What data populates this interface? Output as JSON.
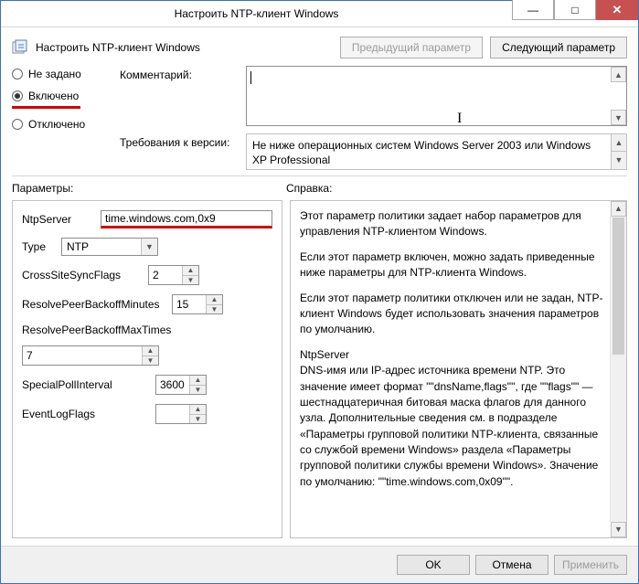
{
  "window": {
    "title": "Настроить NTP-клиент Windows"
  },
  "header": {
    "policy_name": "Настроить NTP-клиент Windows",
    "prev_btn": "Предыдущий параметр",
    "next_btn": "Следующий параметр"
  },
  "state": {
    "not_configured": "Не задано",
    "enabled": "Включено",
    "disabled": "Отключено"
  },
  "labels": {
    "comment": "Комментарий:",
    "requirements": "Требования к версии:",
    "requirements_text": "Не ниже операционных систем Windows Server 2003 или Windows XP Professional",
    "params": "Параметры:",
    "help": "Справка:"
  },
  "params": {
    "ntpserver_label": "NtpServer",
    "ntpserver_value": "time.windows.com,0x9",
    "type_label": "Type",
    "type_value": "NTP",
    "crosssite_label": "CrossSiteSyncFlags",
    "crosssite_value": "2",
    "resolve_label": "ResolvePeerBackoffMinutes",
    "resolve_value": "15",
    "resolvemax_label": "ResolvePeerBackoffMaxTimes",
    "resolvemax_value": "7",
    "special_label": "SpecialPollInterval",
    "special_value": "3600",
    "eventlog_label": "EventLogFlags"
  },
  "help": {
    "p1": "Этот параметр политики задает набор параметров для управления NTP-клиентом Windows.",
    "p2": "Если этот параметр включен, можно задать приведенные ниже параметры для NTP-клиента Windows.",
    "p3": "Если этот параметр политики отключен или не задан, NTP-клиент Windows будет использовать значения параметров по умолчанию.",
    "p4_title": "NtpServer",
    "p4": "DNS-имя или IP-адрес источника времени NTP. Это значение имеет формат \"\"dnsName,flags\"\", где \"\"flags\"\" — шестнадцатеричная битовая маска флагов для данного узла. Дополнительные сведения см. в подразделе «Параметры групповой политики NTP-клиента, связанные со службой времени Windows» раздела «Параметры групповой политики службы времени Windows».   Значение по умолчанию: \"\"time.windows.com,0x09\"\"."
  },
  "footer": {
    "ok": "OK",
    "cancel": "Отмена",
    "apply": "Применить"
  }
}
